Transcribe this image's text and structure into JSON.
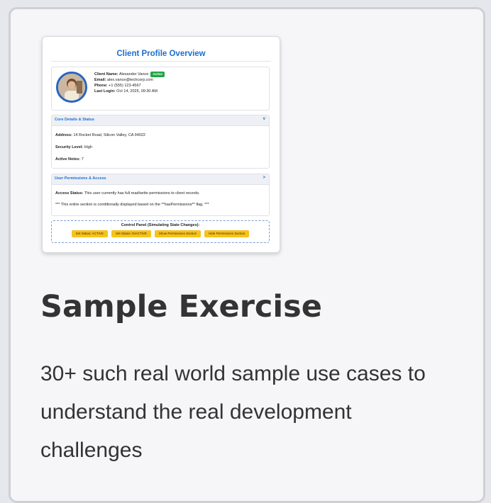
{
  "screenshot": {
    "title": "Client Profile Overview",
    "profile": {
      "name_label": "Client Name:",
      "name": "Alexander Vance",
      "status_badge": "Active",
      "email_label": "Email:",
      "email": "alex.vance@techcorp.com",
      "phone_label": "Phone:",
      "phone": "+1 (555) 123-4567",
      "login_label": "Last Login:",
      "login": "Oct 14, 2025, 09:30 AM"
    },
    "core_panel": {
      "title": "Core Details & Status",
      "chevron": "v",
      "address_label": "Address:",
      "address": "14 Rocket Road, Silicon Valley, CA 94022",
      "security_label": "Security Level:",
      "security": "High",
      "notes_label": "Active Notes:",
      "notes": "7"
    },
    "perm_panel": {
      "title": "User Permissions & Access",
      "chevron": ">",
      "access_label": "Access Status:",
      "access": "This user currently has full read/write permissions to client records.",
      "note": "*** This entire section is conditionally displayed based on the **hasPermissions** flag. ***"
    },
    "control": {
      "title": "Control Panel (Simulating State Changes):",
      "buttons": [
        "Set Status: ACTIVE",
        "Set Status: INACTIVE",
        "Show Permissions Section",
        "Hide Permissions Section"
      ]
    }
  },
  "heading": "Sample Exercise",
  "description": "30+ such real world sample use cases to understand the real development challenges"
}
